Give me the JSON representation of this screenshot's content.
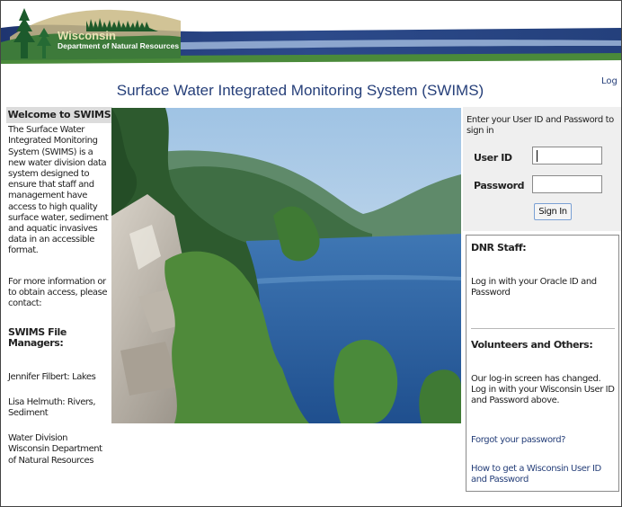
{
  "banner": {
    "agency_line1": "Wisconsin",
    "agency_line2": "Department of Natural Resources",
    "colors": {
      "navy": "#27407a",
      "green": "#4a8a3a",
      "accent": "#e9e3b4"
    }
  },
  "header": {
    "title": "Surface Water Integrated Monitoring System (SWIMS)",
    "login_link": "Log In"
  },
  "sidebar": {
    "welcome_heading": "Welcome to SWIMS",
    "intro": "The Surface Water Integrated Monitoring System (SWIMS) is a new water division data system designed to ensure that staff and management have access to high quality surface water, sediment and aquatic invasives data in an accessible format.",
    "more_info": "For more information or to obtain access, please contact:",
    "managers_heading": "SWIMS File Managers:",
    "manager1": "Jennifer Filbert: Lakes",
    "manager2": "Lisa Helmuth: Rivers, Sediment",
    "division": "Water Division Wisconsin Department of Natural Resources"
  },
  "signin": {
    "intro": "Enter your User ID and Password to sign in",
    "user_label": "User ID",
    "password_label": "Password",
    "user_value": "",
    "password_value": "",
    "button_label": "Sign In"
  },
  "info": {
    "dnr_heading": "DNR Staff:",
    "dnr_text": "Log in with your Oracle ID and Password",
    "vol_heading": "Volunteers and Others:",
    "vol_text": "Our log-in screen has changed. Log in with your Wisconsin User ID and Password above.",
    "forgot_link": "Forgot your password?",
    "howto_link": "How to get a Wisconsin User ID and Password"
  }
}
